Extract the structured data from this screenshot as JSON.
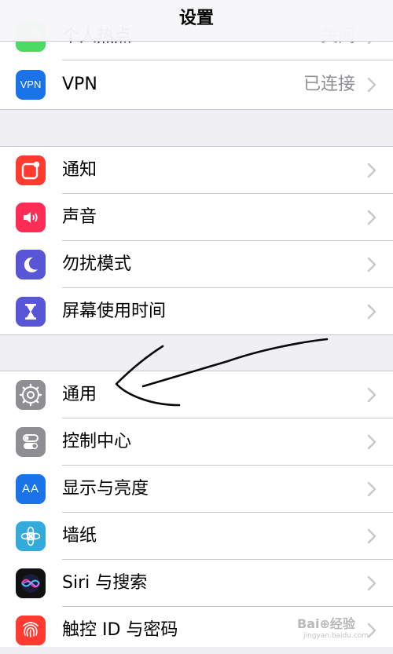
{
  "header": {
    "title": "设置"
  },
  "hotspot": {
    "label": "个人热点",
    "value": "关闭"
  },
  "vpn": {
    "icon_text": "VPN",
    "label": "VPN",
    "value": "已连接"
  },
  "group2": {
    "items": [
      {
        "label": "通知",
        "color": "#ff3b30",
        "icon": "notifications-icon"
      },
      {
        "label": "声音",
        "color": "#ff2d55",
        "icon": "speaker-icon"
      },
      {
        "label": "勿扰模式",
        "color": "#5856d6",
        "icon": "moon-icon"
      },
      {
        "label": "屏幕使用时间",
        "color": "#5856d6",
        "icon": "hourglass-icon"
      }
    ]
  },
  "group3": {
    "items": [
      {
        "label": "通用",
        "color": "#8e8e93",
        "icon": "gear-icon"
      },
      {
        "label": "控制中心",
        "color": "#8e8e93",
        "icon": "toggles-icon"
      },
      {
        "label": "显示与亮度",
        "color": "#1a73e8",
        "icon_text": "AA",
        "icon": "text-size-icon"
      },
      {
        "label": "墙纸",
        "color": "#34aadc",
        "icon": "flower-icon"
      },
      {
        "label": "Siri 与搜索",
        "color": "#000000",
        "icon": "siri-icon"
      },
      {
        "label": "触控 ID 与密码",
        "color": "#ff3b30",
        "icon": "fingerprint-icon"
      }
    ]
  },
  "watermark": {
    "logo": "Bai⊕经验",
    "site": "jingyan.baidu.com"
  }
}
